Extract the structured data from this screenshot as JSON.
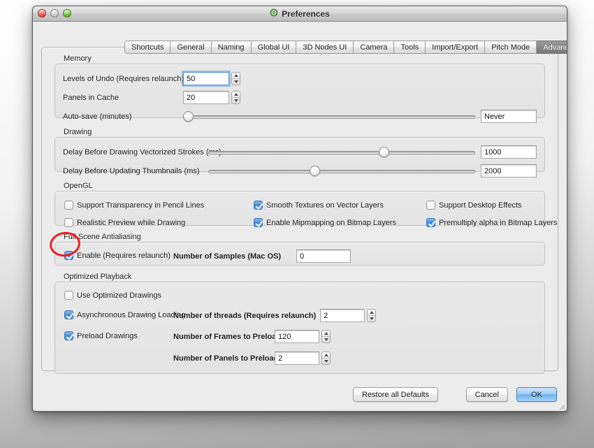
{
  "window": {
    "title": "Preferences",
    "title_icon": "target-icon",
    "lights": {
      "close": "close-button",
      "minimize": "minimize-button",
      "zoom": "zoom-button"
    }
  },
  "tabs": [
    {
      "label": "Shortcuts",
      "selected": false
    },
    {
      "label": "General",
      "selected": false
    },
    {
      "label": "Naming",
      "selected": false
    },
    {
      "label": "Global UI",
      "selected": false
    },
    {
      "label": "3D Nodes UI",
      "selected": false
    },
    {
      "label": "Camera",
      "selected": false
    },
    {
      "label": "Tools",
      "selected": false
    },
    {
      "label": "Import/Export",
      "selected": false
    },
    {
      "label": "Pitch Mode",
      "selected": false
    },
    {
      "label": "Advanced",
      "selected": true
    }
  ],
  "memory": {
    "title": "Memory",
    "levels_of_undo": {
      "label": "Levels of Undo (Requires relaunch)",
      "value": "50"
    },
    "panels_in_cache": {
      "label": "Panels in Cache",
      "value": "20"
    },
    "auto_save": {
      "label": "Auto-save (minutes)",
      "value": "Never"
    }
  },
  "drawing": {
    "title": "Drawing",
    "vectorized_strokes": {
      "label": "Delay Before Drawing Vectorized Strokes (ms)",
      "value": "1000"
    },
    "updating_thumbnails": {
      "label": "Delay Before Updating Thumbnails (ms)",
      "value": "2000"
    }
  },
  "opengl": {
    "title": "OpenGL",
    "options": [
      {
        "label": "Support Transparency in Pencil Lines",
        "checked": false
      },
      {
        "label": "Smooth Textures on Vector Layers",
        "checked": true
      },
      {
        "label": "Support Desktop Effects",
        "checked": false
      },
      {
        "label": "Realistic Preview while Drawing",
        "checked": false
      },
      {
        "label": "Enable Mipmapping on Bitmap Layers",
        "checked": true
      },
      {
        "label": "Premultiply alpha in Bitmap Layers",
        "checked": true
      }
    ]
  },
  "antialiasing": {
    "title": "Full Scene Antialiasing",
    "enable": {
      "label": "Enable (Requires relaunch)",
      "checked": true
    },
    "samples": {
      "label": "Number of Samples (Mac OS)",
      "value": "0"
    }
  },
  "playback": {
    "title": "Optimized Playback",
    "use_optimized": {
      "label": "Use Optimized Drawings",
      "checked": false
    },
    "async_loading": {
      "label": "Asynchronous Drawing Loading",
      "checked": true
    },
    "threads": {
      "label": "Number of threads (Requires relaunch)",
      "value": "2"
    },
    "preload_drawings": {
      "label": "Preload Drawings",
      "checked": true
    },
    "frames_to_preload": {
      "label": "Number of Frames to Preload",
      "value": "120"
    },
    "panels_to_preload": {
      "label": "Number of Panels to Preload",
      "value": "2"
    }
  },
  "footer": {
    "restore": "Restore all Defaults",
    "cancel": "Cancel",
    "ok": "OK"
  },
  "colors": {
    "accent": "#4a92da",
    "annotation": "#ee1c24",
    "selected_tab": "#8c8c8c"
  }
}
